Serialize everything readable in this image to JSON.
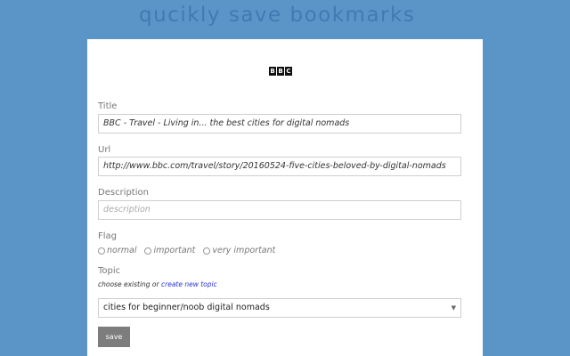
{
  "banner": {
    "text": "qucikly save bookmarks"
  },
  "logo": {
    "letters": [
      "B",
      "B",
      "C"
    ]
  },
  "form": {
    "title_label": "Title",
    "title_value": "BBC - Travel - Living in... the best cities for digital nomads",
    "url_label": "Url",
    "url_value": "http://www.bbc.com/travel/story/20160524-five-cities-beloved-by-digital-nomads",
    "description_label": "Description",
    "description_placeholder": "description",
    "flag_label": "Flag",
    "flags": [
      "normal",
      "important",
      "very important"
    ],
    "topic_label": "Topic",
    "topic_hint_prefix": "choose existing or",
    "topic_hint_link": "create new topic",
    "topic_selected": "cities for beginner/noob digital nomads",
    "save_label": "save"
  },
  "colors": {
    "background": "#5b95c8",
    "banner_text": "#3f7ab2",
    "link": "#2a33d6",
    "button": "#7d7d7d"
  }
}
